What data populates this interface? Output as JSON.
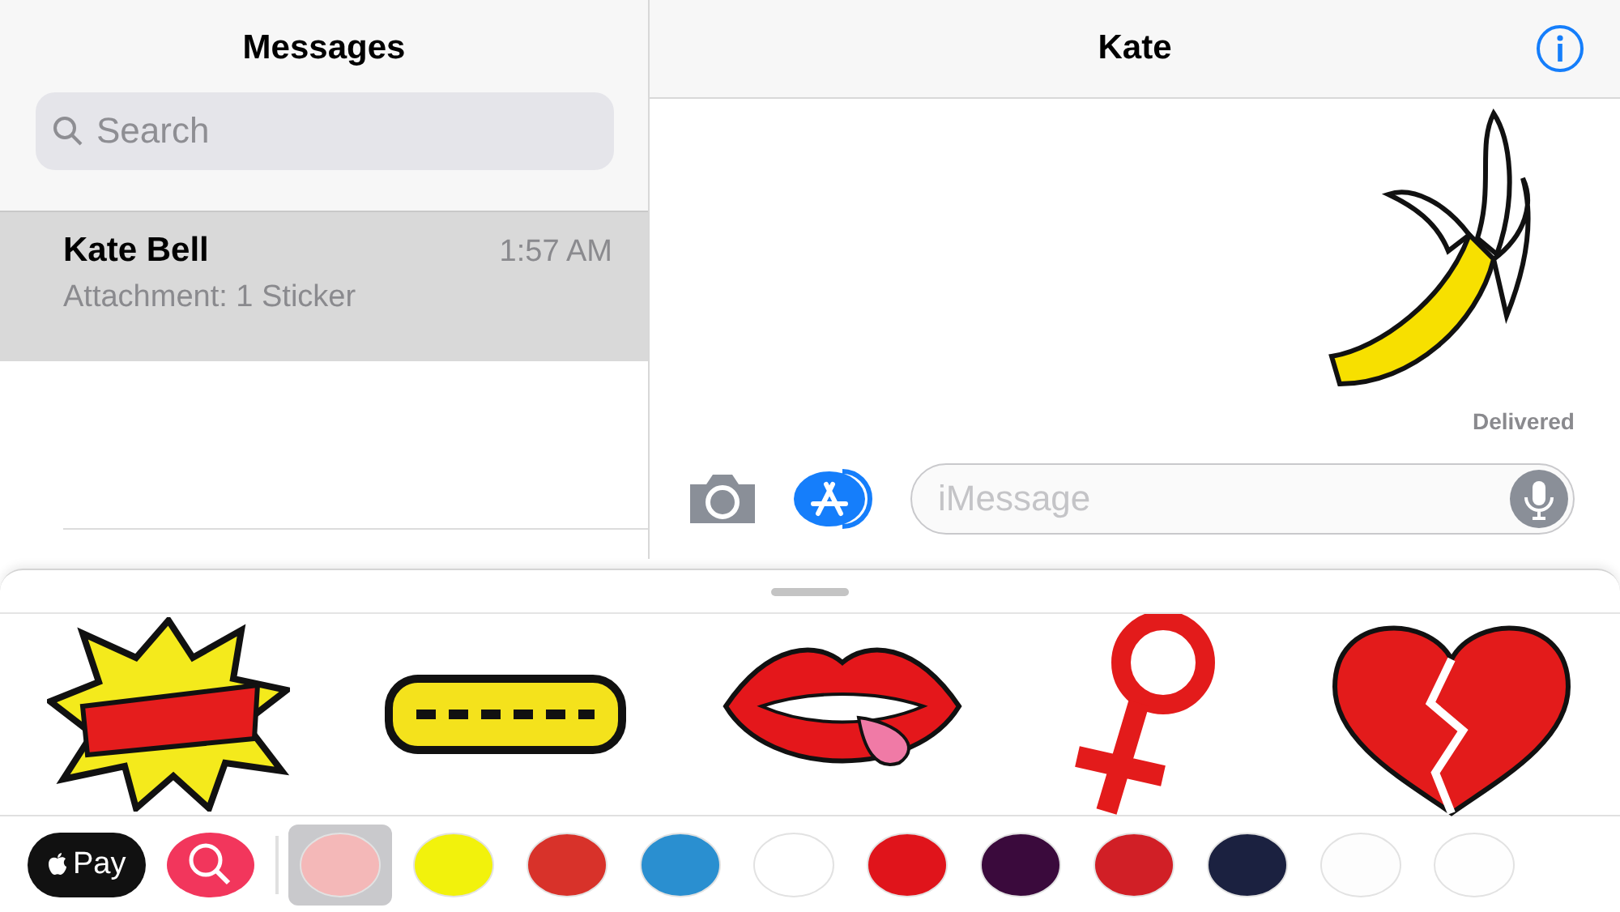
{
  "sidebar": {
    "title": "Messages",
    "search": {
      "placeholder": "Search"
    },
    "conversations": [
      {
        "name": "Kate Bell",
        "time": "1:57 AM",
        "preview": "Attachment: 1 Sticker",
        "selected": true
      }
    ]
  },
  "chat": {
    "title": "Kate",
    "message": {
      "kind": "banana",
      "status": "Delivered"
    },
    "composer": {
      "placeholder": "iMessage"
    }
  },
  "sticker_panel": {
    "stickers": [
      {
        "kind": "burst"
      },
      {
        "kind": "word"
      },
      {
        "kind": "lips"
      },
      {
        "kind": "female-sign"
      },
      {
        "kind": "broken-heart"
      }
    ]
  },
  "app_drawer": [
    {
      "kind": "pay",
      "label": "Pay",
      "selected": false
    },
    {
      "kind": "search",
      "selected": false
    },
    {
      "kind": "pack",
      "color": "#f4b8b8",
      "selected": true
    },
    {
      "kind": "pack",
      "color": "#f2f20c",
      "selected": false
    },
    {
      "kind": "pack",
      "color": "#d8322a",
      "selected": false
    },
    {
      "kind": "pack",
      "color": "#2a8fd0",
      "selected": false
    },
    {
      "kind": "pack",
      "color": "#ffffff",
      "selected": false
    },
    {
      "kind": "pack",
      "color": "#e0141b",
      "selected": false
    },
    {
      "kind": "pack",
      "color": "#3a0a3c",
      "selected": false
    },
    {
      "kind": "pack",
      "color": "#d11f26",
      "selected": false
    },
    {
      "kind": "pack",
      "color": "#1b2140",
      "selected": false
    },
    {
      "kind": "pack",
      "color": "#fdfdfd",
      "selected": false
    },
    {
      "kind": "pack",
      "color": "#fefefe",
      "selected": false
    }
  ]
}
